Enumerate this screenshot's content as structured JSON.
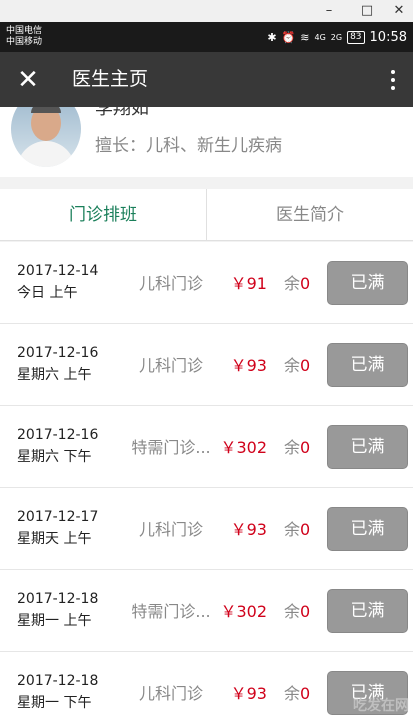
{
  "window": {
    "minimize_glyph": "–",
    "maximize_glyph": "□",
    "close_glyph": "✕"
  },
  "status": {
    "carrier1": "中国电信",
    "carrier2": "中国移动",
    "signal1": "4G",
    "signal2": "2G",
    "battery": "83",
    "time": "10:58",
    "bluetooth_glyph": "✱",
    "alarm_glyph": "⏰",
    "wifi_glyph": "≋"
  },
  "appbar": {
    "title": "医生主页",
    "close_glyph": "✕"
  },
  "doctor": {
    "name": "李翔如",
    "specialty": "擅长：儿科、新生儿疾病"
  },
  "tabs": [
    {
      "label": "门诊排班",
      "active": true
    },
    {
      "label": "医生简介",
      "active": false
    }
  ],
  "schedule": [
    {
      "date": "2017-12-14",
      "day": "今日  上午",
      "type": "儿科门诊",
      "price": "￥91",
      "remain_label": "余",
      "remain": "0",
      "status": "已满"
    },
    {
      "date": "2017-12-16",
      "day": "星期六  上午",
      "type": "儿科门诊",
      "price": "￥93",
      "remain_label": "余",
      "remain": "0",
      "status": "已满"
    },
    {
      "date": "2017-12-16",
      "day": "星期六  下午",
      "type": "特需门诊...",
      "price": "￥302",
      "remain_label": "余",
      "remain": "0",
      "status": "已满"
    },
    {
      "date": "2017-12-17",
      "day": "星期天  上午",
      "type": "儿科门诊",
      "price": "￥93",
      "remain_label": "余",
      "remain": "0",
      "status": "已满"
    },
    {
      "date": "2017-12-18",
      "day": "星期一  上午",
      "type": "特需门诊...",
      "price": "￥302",
      "remain_label": "余",
      "remain": "0",
      "status": "已满"
    },
    {
      "date": "2017-12-18",
      "day": "星期一  下午",
      "type": "儿科门诊",
      "price": "￥93",
      "remain_label": "余",
      "remain": "0",
      "status": "已满"
    }
  ],
  "watermark": "吃发在网",
  "colors": {
    "accent_green": "#1a7f5a",
    "price_red": "#d0021b",
    "appbar": "#383838",
    "button_gray": "#999999"
  }
}
